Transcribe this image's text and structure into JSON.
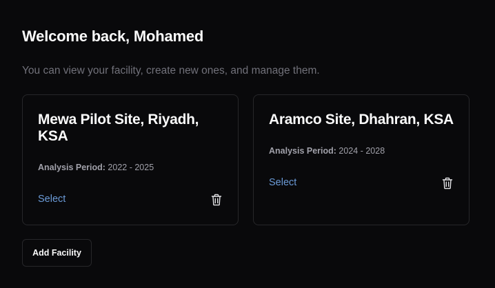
{
  "header": {
    "title": "Welcome back, Mohamed",
    "subtitle": "You can view your facility, create new ones, and manage them."
  },
  "facilities": [
    {
      "name": "Mewa Pilot Site, Riyadh, KSA",
      "period_label": "Analysis Period:",
      "period_value": " 2022 - 2025",
      "select_label": "Select",
      "delete_icon": "trash-icon"
    },
    {
      "name": "Aramco Site, Dhahran, KSA",
      "period_label": "Analysis Period:",
      "period_value": " 2024 - 2028",
      "select_label": "Select",
      "delete_icon": "trash-icon"
    }
  ],
  "actions": {
    "add_facility_label": "Add Facility"
  },
  "colors": {
    "background": "#09090b",
    "border": "#27272a",
    "link": "#6b9bd8",
    "muted_text": "#71717a"
  }
}
